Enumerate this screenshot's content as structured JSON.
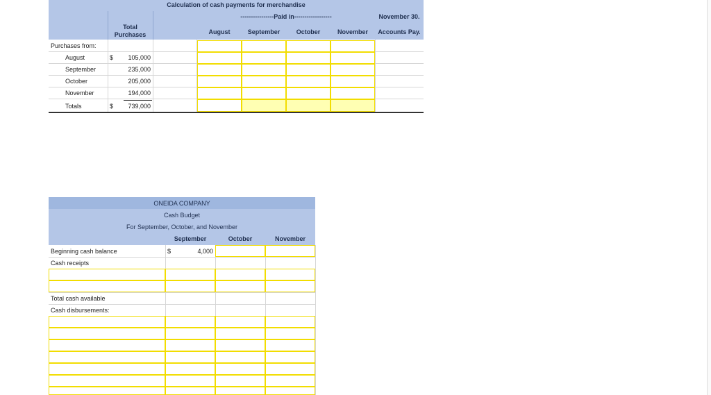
{
  "table1": {
    "title": "Calculation of cash payments for merchandise",
    "paid_in": "----------------Paid in------------------",
    "total_purchases": "Total\nPurchases",
    "nov30": "November 30.",
    "columns": [
      "August",
      "September",
      "October",
      "November",
      "Accounts Pay."
    ],
    "purchases_from": "Purchases from:",
    "rows": [
      {
        "label": "August",
        "dollar": "$",
        "amount": "105,000"
      },
      {
        "label": "September",
        "dollar": "",
        "amount": "235,000"
      },
      {
        "label": "October",
        "dollar": "",
        "amount": "205,000"
      },
      {
        "label": "November",
        "dollar": "",
        "amount": "194,000"
      },
      {
        "label": "Totals",
        "dollar": "$",
        "amount": "739,000"
      }
    ]
  },
  "table2": {
    "company": "ONEIDA COMPANY",
    "title": "Cash Budget",
    "period": "For September, October, and November",
    "columns": [
      "September",
      "October",
      "November"
    ],
    "beginning_cash_label": "Beginning cash balance",
    "beginning_dollar": "$",
    "beginning_value": "4,000",
    "cash_receipts_label": "Cash receipts",
    "total_cash_label": "Total cash available",
    "disbursements_label": "Cash disbursements:"
  },
  "colors": {
    "header_fill": "#b4c6e7",
    "input_border": "#f2dd00",
    "input_highlight": "#ffffb3"
  }
}
